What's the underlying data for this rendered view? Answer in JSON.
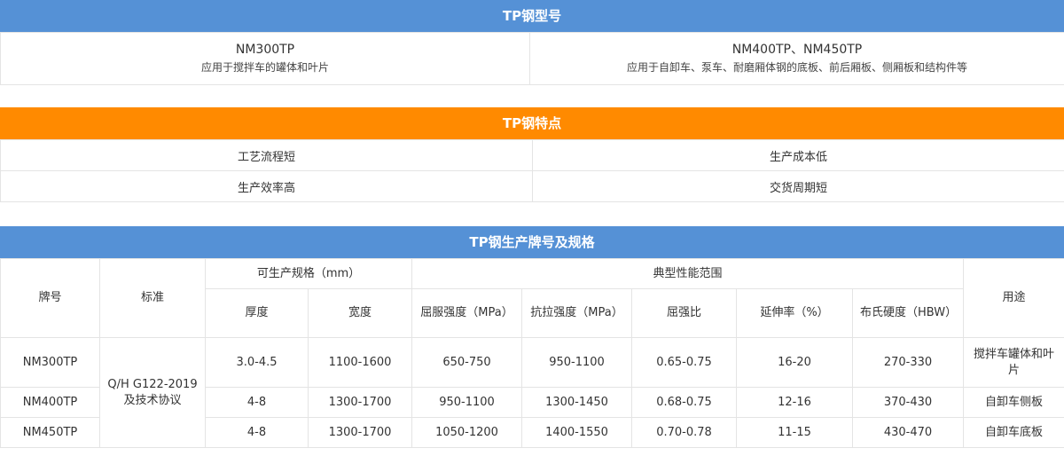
{
  "section1": {
    "title": "TP钢型号",
    "left": {
      "name": "NM300TP",
      "use": "应用于搅拌车的罐体和叶片"
    },
    "right": {
      "name": "NM400TP、NM450TP",
      "use": "应用于自卸车、泵车、耐磨厢体钢的底板、前后厢板、侧厢板和结构件等"
    }
  },
  "section2": {
    "title": "TP钢特点",
    "rows": [
      [
        "工艺流程短",
        "生产成本低"
      ],
      [
        "生产效率高",
        "交货周期短"
      ]
    ]
  },
  "section3": {
    "title": "TP钢生产牌号及规格",
    "headers": {
      "grade": "牌号",
      "standard": "标准",
      "spec_group": "可生产规格（mm）",
      "thickness": "厚度",
      "width": "宽度",
      "perf_group": "典型性能范围",
      "yield": "屈服强度（MPa）",
      "tensile": "抗拉强度（MPa）",
      "ratio": "屈强比",
      "elongation": "延伸率（%）",
      "hardness": "布氏硬度（HBW）",
      "use": "用途"
    },
    "standard_value": "Q/H G122-2019 及技术协议",
    "rows": [
      {
        "grade": "NM300TP",
        "thickness": "3.0-4.5",
        "width": "1100-1600",
        "yield": "650-750",
        "tensile": "950-1100",
        "ratio": "0.65-0.75",
        "elongation": "16-20",
        "hardness": "270-330",
        "use": "搅拌车罐体和叶片"
      },
      {
        "grade": "NM400TP",
        "thickness": "4-8",
        "width": "1300-1700",
        "yield": "950-1100",
        "tensile": "1300-1450",
        "ratio": "0.68-0.75",
        "elongation": "12-16",
        "hardness": "370-430",
        "use": "自卸车侧板"
      },
      {
        "grade": "NM450TP",
        "thickness": "4-8",
        "width": "1300-1700",
        "yield": "1050-1200",
        "tensile": "1400-1550",
        "ratio": "0.70-0.78",
        "elongation": "11-15",
        "hardness": "430-470",
        "use": "自卸车底板"
      }
    ]
  }
}
